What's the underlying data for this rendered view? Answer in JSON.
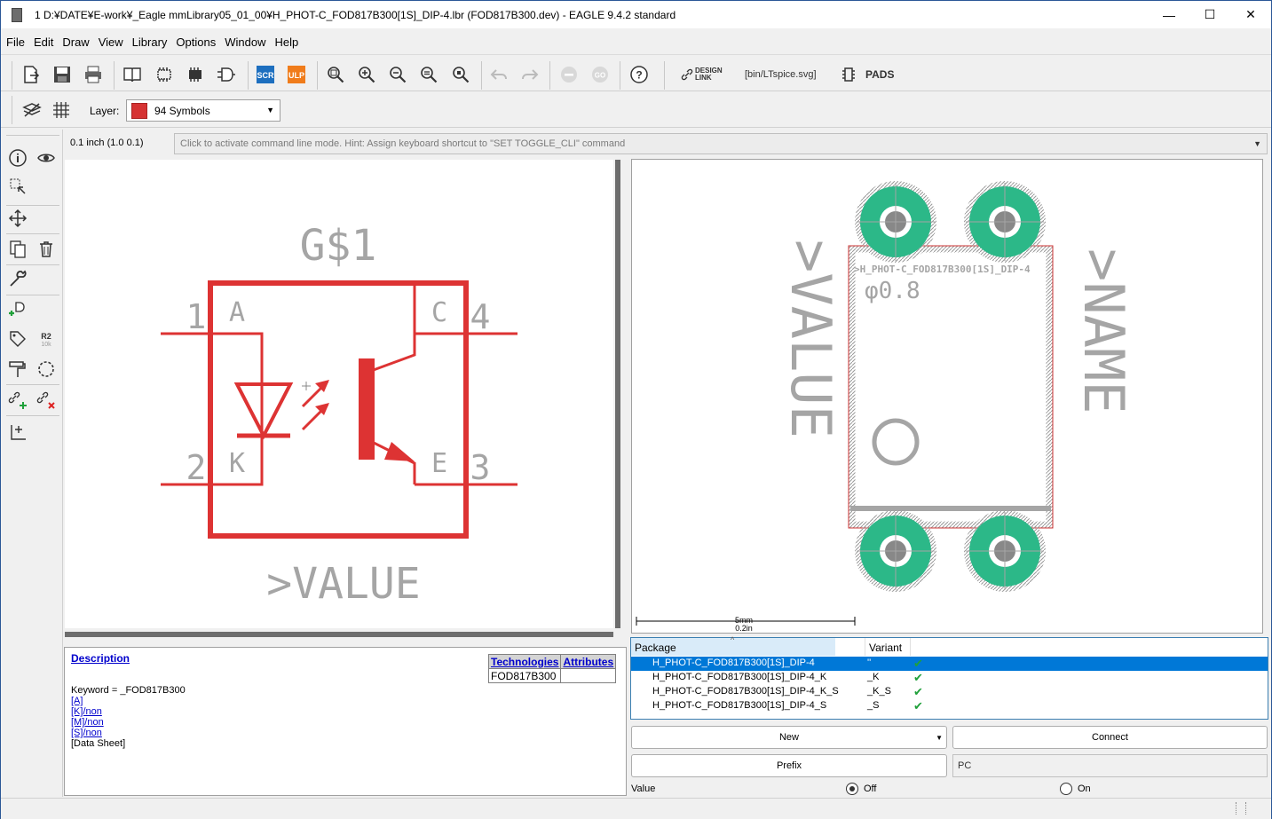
{
  "window": {
    "title": "1 D:¥DATE¥E-work¥_Eagle mmLibrary05_01_00¥H_PHOT-C_FOD817B300[1S]_DIP-4.lbr (FOD817B300.dev) - EAGLE 9.4.2 standard",
    "minimize": "—",
    "maximize": "☐",
    "close": "✕"
  },
  "menu": [
    "File",
    "Edit",
    "Draw",
    "View",
    "Library",
    "Options",
    "Window",
    "Help"
  ],
  "toolbar": {
    "scr": "SCR",
    "ulp": "ULP",
    "design_link": "DESIGN LINK",
    "ltspice": "[bin/LTspice.svg]",
    "pads": "PADS",
    "help": "?"
  },
  "layer": {
    "label": "Layer:",
    "value": "94 Symbols",
    "color": "#d63333"
  },
  "grid_info": "0.1 inch (1.0 0.1)",
  "command_hint": "Click to activate command line mode. Hint: Assign keyboard shortcut to \"SET TOGGLE_CLI\" command",
  "symbol": {
    "name": "G$1",
    "value": ">VALUE",
    "pins": [
      {
        "num": "1",
        "name": "A"
      },
      {
        "num": "2",
        "name": "K"
      },
      {
        "num": "4",
        "name": "C"
      },
      {
        "num": "3",
        "name": "E"
      }
    ]
  },
  "package_view": {
    "value_text": ">VALUE",
    "name_text": ">NAME",
    "package_label": ">H_PHOT-C_FOD817B300[1S]_DIP-4",
    "drill_text": "φ0.8",
    "scale_mm": "5mm",
    "scale_in": "0.2in"
  },
  "description": {
    "title": "Description",
    "keyword": "Keyword = _FOD817B300",
    "links": [
      "[A]",
      "[K]/non",
      "[M]/non",
      "[S]/non"
    ],
    "datasheet": "[Data Sheet]"
  },
  "technologies": {
    "col1": "Technologies",
    "col2": "Attributes",
    "row1": "FOD817B300"
  },
  "packages": {
    "header_package": "Package",
    "header_variant": "Variant",
    "rows": [
      {
        "name": "H_PHOT-C_FOD817B300[1S]_DIP-4",
        "variant": "''",
        "ok": "✔"
      },
      {
        "name": "H_PHOT-C_FOD817B300[1S]_DIP-4_K",
        "variant": "_K",
        "ok": "✔"
      },
      {
        "name": "H_PHOT-C_FOD817B300[1S]_DIP-4_K_S",
        "variant": "_K_S",
        "ok": "✔"
      },
      {
        "name": "H_PHOT-C_FOD817B300[1S]_DIP-4_S",
        "variant": "_S",
        "ok": "✔"
      }
    ]
  },
  "buttons": {
    "new": "New",
    "connect": "Connect",
    "prefix": "Prefix",
    "prefix_value": "PC"
  },
  "value_setting": {
    "label": "Value",
    "off": "Off",
    "on": "On"
  }
}
